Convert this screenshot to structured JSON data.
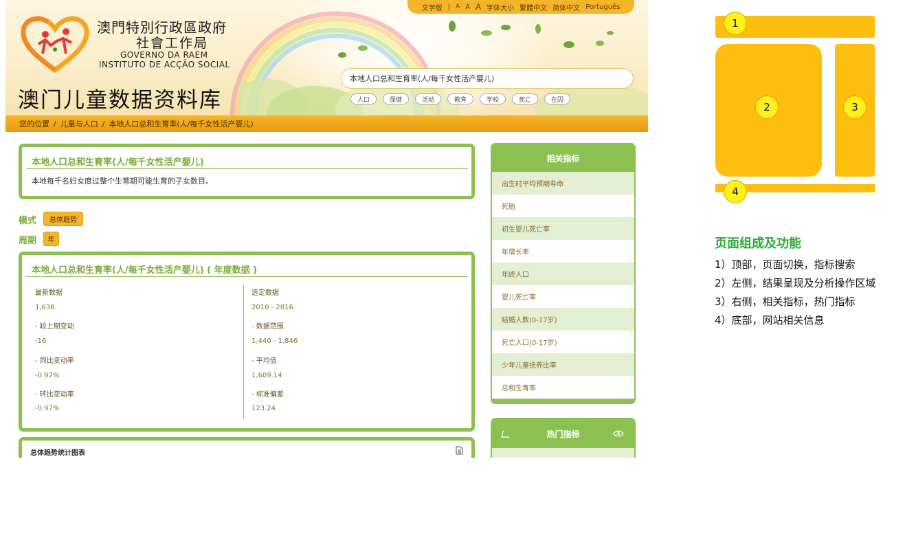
{
  "header": {
    "top_links": [
      "文字版",
      "|",
      "A",
      "A",
      "A",
      "字体大小",
      "繁體中文",
      "简体中文",
      "Português"
    ],
    "org_zh_line1": "澳門特別行政區政府",
    "org_zh_line2": "社會工作局",
    "org_pt_line1": "GOVERNO DA RAEM",
    "org_pt_line2": "INSTITUTO DE ACÇÃO SOCIAL",
    "site_title": "澳门儿童数据资料库",
    "search_value": "本地人口总和生育率(人/每千女性活产婴儿)",
    "categories": [
      "人口",
      "保健",
      "活动",
      "教育",
      "学校",
      "死亡",
      "在囚"
    ]
  },
  "breadcrumb": [
    "您的位置",
    "/",
    "儿童与人口",
    "/",
    "本地人口总和生育率(人/每千女性活产婴儿)"
  ],
  "definition": {
    "title": "本地人口总和生育率(人/每千女性活产婴儿)",
    "description": "本地每千名妇女度过整个生育期可能生育的子女数目。"
  },
  "options": {
    "mode_label": "模式",
    "mode_value": "总体趋势",
    "period_label": "周期",
    "period_value": "年"
  },
  "annual": {
    "title": "本地人口总和生育率(人/每千女性活产婴儿) ( 年度数据 )",
    "left": [
      {
        "label": "最新数据",
        "value": "1,638"
      },
      {
        "label": "- 较上期变动",
        "value": "-16"
      },
      {
        "label": "- 同比变动率",
        "value": "-0.97%"
      },
      {
        "label": "- 环比变动率",
        "value": "-0.97%"
      }
    ],
    "right": [
      {
        "label": "选定数据",
        "value": "2010 - 2016"
      },
      {
        "label": "- 数据范围",
        "value": "1,440 - 1,846"
      },
      {
        "label": "- 平均值",
        "value": "1,609.14"
      },
      {
        "label": "- 标准偏差",
        "value": "123.24"
      }
    ]
  },
  "trend_chart": {
    "title": "总体趋势统计图表"
  },
  "related": {
    "title": "相关指标",
    "items": [
      "出生时平均预期寿命",
      "死胎",
      "初生婴儿死亡率",
      "年增长率",
      "年终人口",
      "婴儿死亡率",
      "结婚人数(0-17岁)",
      "死亡人口(0-17岁)",
      "少年儿童抚养比率",
      "总和生育率"
    ]
  },
  "hot": {
    "title": "热门指标"
  },
  "diagram": {
    "badges": [
      "1",
      "2",
      "3",
      "4"
    ],
    "block_color": "#fdbe10",
    "badge_color": "#ffef1a"
  },
  "legend": {
    "title": "页面组成及功能",
    "lines": [
      "1）顶部，页面切换，指标搜索",
      "2）左侧，结果呈现及分析操作区域",
      "3）右侧，相关指标，热门指标",
      "4）底部，网站相关信息"
    ]
  },
  "colors": {
    "accent_green": "#8cc151",
    "accent_orange": "#f6b42a",
    "legend_green": "#2aa836"
  }
}
